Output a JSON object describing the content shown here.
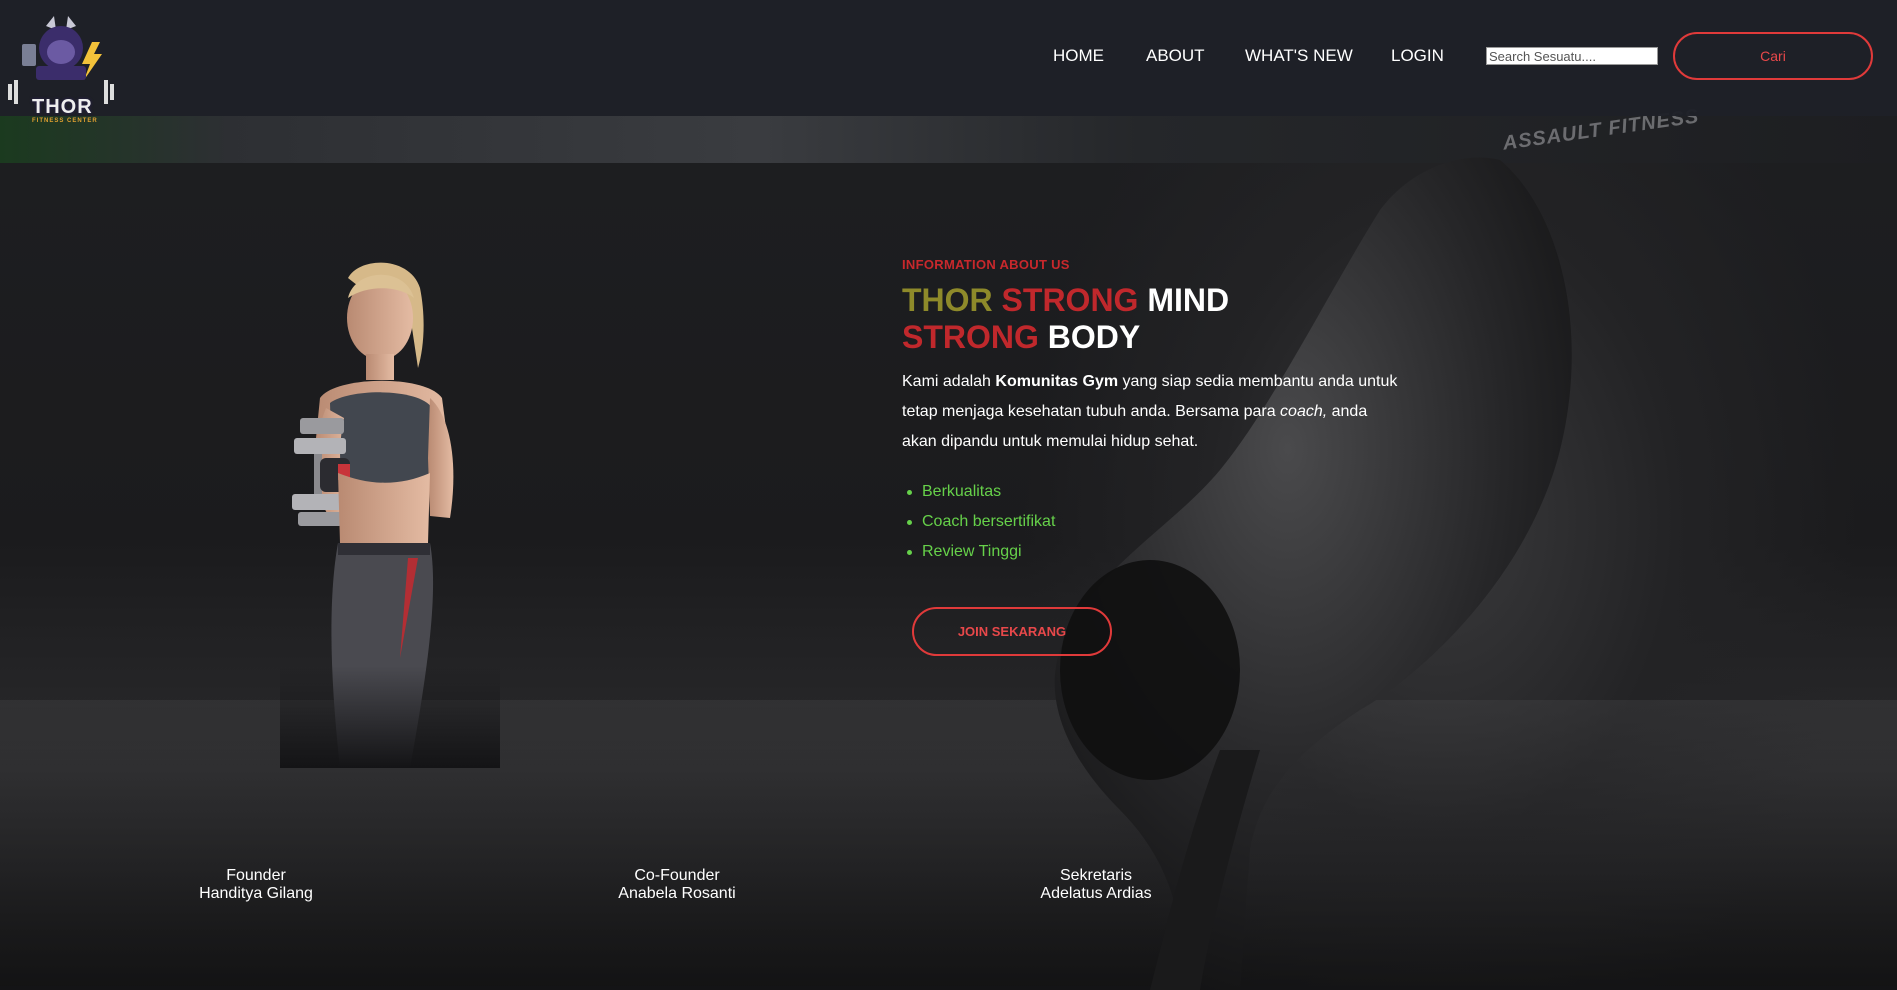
{
  "brand": {
    "logo_text": "THOR",
    "logo_subtext": "FITNESS CENTER"
  },
  "nav": {
    "items": [
      {
        "label": "HOME"
      },
      {
        "label": "ABOUT"
      },
      {
        "label": "WHAT'S NEW"
      },
      {
        "label": "LOGIN"
      }
    ]
  },
  "search": {
    "placeholder": "Search Sesuatu....",
    "value": "",
    "button_label": "Cari"
  },
  "background": {
    "equipment_label": "ASSAULT FITNESS"
  },
  "hero": {
    "eyebrow": "INFORMATION ABOUT US",
    "headline": {
      "line1": {
        "w1": "THOR",
        "w2": "STRONG",
        "w3": "MIND"
      },
      "line2": {
        "w1": "STRONG",
        "w2": "BODY"
      }
    },
    "description": {
      "part1": "Kami adalah ",
      "bold": "Komunitas Gym",
      "part2": " yang siap sedia membantu anda untuk tetap menjaga kesehatan tubuh anda. Bersama para ",
      "italic": "coach,",
      "part3": " anda akan dipandu untuk memulai hidup sehat."
    },
    "features": [
      "Berkualitas",
      "Coach bersertifikat",
      "Review Tinggi"
    ],
    "cta_label": "JOIN SEKARANG"
  },
  "team": [
    {
      "role": "Founder",
      "name": "Handitya Gilang"
    },
    {
      "role": "Co-Founder",
      "name": "Anabela Rosanti"
    },
    {
      "role": "Sekretaris",
      "name": "Adelatus Ardias"
    }
  ],
  "colors": {
    "header_bg": "#1e2028",
    "accent_red": "#e03a3a",
    "headline_olive": "#8e8a2a",
    "headline_red": "#c0282c",
    "feature_green": "#66d14a"
  }
}
